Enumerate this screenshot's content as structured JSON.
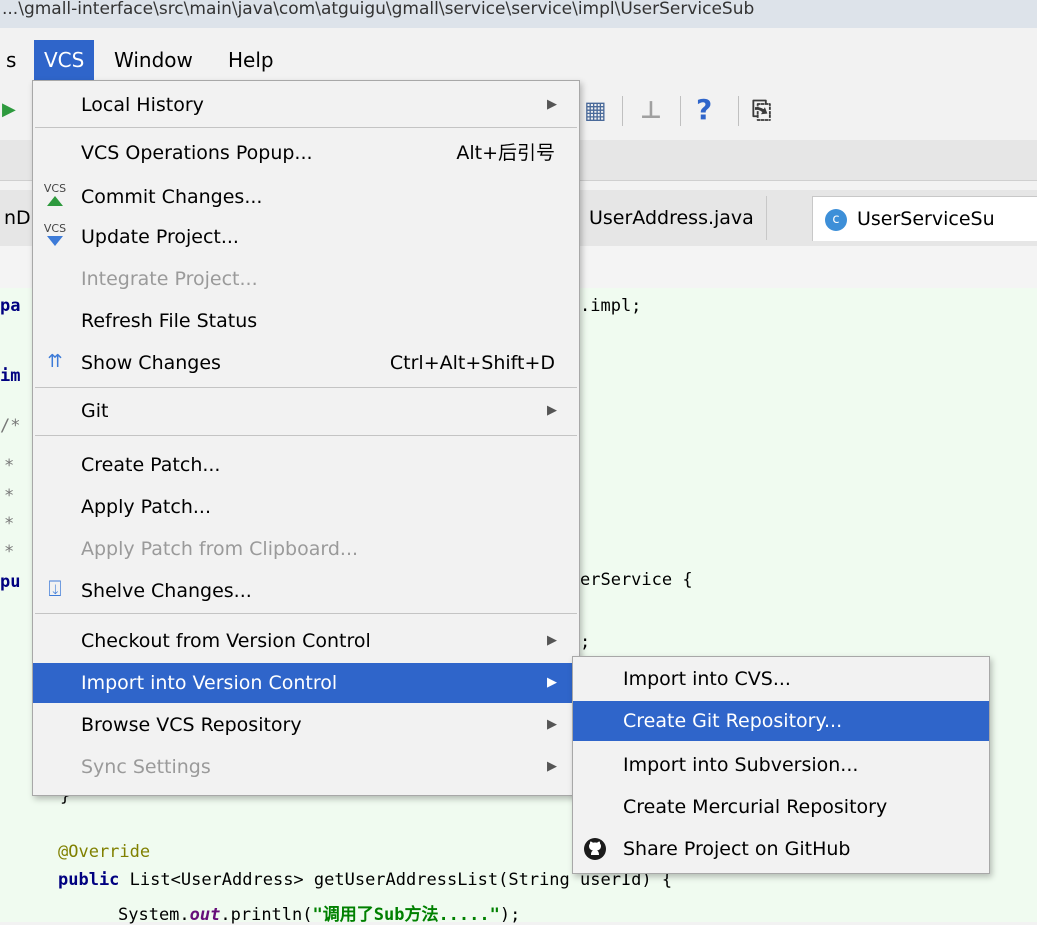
{
  "window": {
    "path_title": "...\\gmall-interface\\src\\main\\java\\com\\atguigu\\gmall\\service\\service\\impl\\UserServiceSub"
  },
  "menubar": {
    "partial_left": "s",
    "vcs": "VCS",
    "window": "Window",
    "help": "Help"
  },
  "tabs": {
    "partial_left": "nD",
    "user_address": "UserAddress.java",
    "user_service_sub": "UserServiceSu",
    "class_icon": "c"
  },
  "editor": {
    "line_package": ".impl;",
    "line_class": "erService {",
    "line_semicolon": ";",
    "gutter_pa": "pa",
    "gutter_im": "im",
    "gutter_comment1": "/*",
    "gutter_star": "*",
    "gutter_pu": "pu",
    "line_brace": "}",
    "annotation": "@Override",
    "kw_public": "public",
    "method_sig": "List<UserAddress> getUserAddressList(String userId) {",
    "print_prefix": "System.",
    "print_field": "out",
    "print_call": ".println(",
    "print_string": "\"调用了Sub方法.....\"",
    "print_end": ");"
  },
  "vcs_menu": {
    "items": [
      {
        "label": "Local History",
        "submenu": true
      },
      {
        "label": "VCS Operations Popup...",
        "shortcut": "Alt+后引号"
      },
      {
        "label": "Commit Changes...",
        "icon": "vcs-commit-icon",
        "icon_text": "VCS"
      },
      {
        "label": "Update Project...",
        "icon": "vcs-update-icon",
        "icon_text": "VCS"
      },
      {
        "label": "Integrate Project...",
        "disabled": true
      },
      {
        "label": "Refresh File Status"
      },
      {
        "label": "Show Changes",
        "shortcut": "Ctrl+Alt+Shift+D",
        "icon": "show-changes-icon"
      },
      {
        "label": "Git",
        "submenu": true
      },
      {
        "label": "Create Patch..."
      },
      {
        "label": "Apply Patch..."
      },
      {
        "label": "Apply Patch from Clipboard...",
        "disabled": true
      },
      {
        "label": "Shelve Changes...",
        "icon": "shelve-icon"
      },
      {
        "label": "Checkout from Version Control",
        "submenu": true
      },
      {
        "label": "Import into Version Control",
        "submenu": true,
        "highlighted": true
      },
      {
        "label": "Browse VCS Repository",
        "submenu": true
      },
      {
        "label": "Sync Settings",
        "submenu": true,
        "disabled": true
      }
    ]
  },
  "import_submenu": {
    "items": [
      {
        "label": "Import into CVS..."
      },
      {
        "label": "Create Git Repository...",
        "highlighted": true
      },
      {
        "label": "Import into Subversion..."
      },
      {
        "label": "Create Mercurial Repository"
      },
      {
        "label": "Share Project on GitHub",
        "icon": "github-icon"
      }
    ]
  },
  "colors": {
    "highlight": "#2f65ca",
    "editor_bg": "#f0fbf0",
    "menu_bg": "#f2f2f2"
  }
}
